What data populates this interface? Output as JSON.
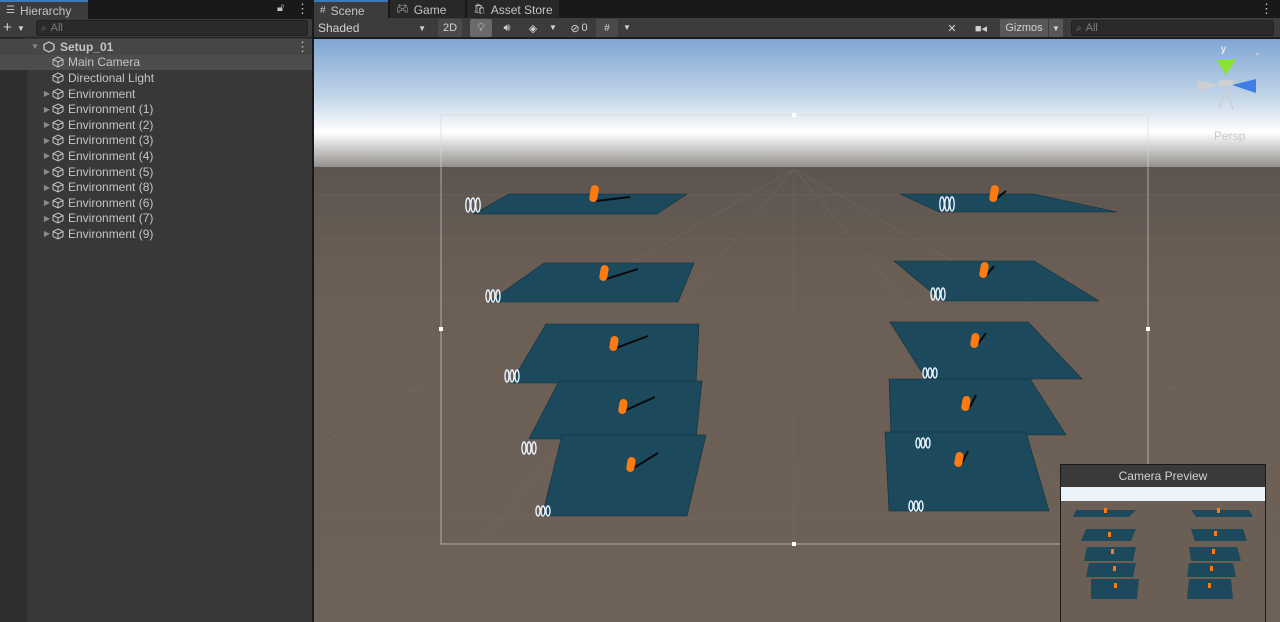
{
  "hierarchy": {
    "tab_label": "Hierarchy",
    "search_placeholder": "All",
    "scene_name": "Setup_01",
    "items": [
      {
        "label": "Main Camera",
        "expandable": false
      },
      {
        "label": "Directional Light",
        "expandable": false
      },
      {
        "label": "Environment",
        "expandable": true
      },
      {
        "label": "Environment (1)",
        "expandable": true
      },
      {
        "label": "Environment (2)",
        "expandable": true
      },
      {
        "label": "Environment (3)",
        "expandable": true
      },
      {
        "label": "Environment (4)",
        "expandable": true
      },
      {
        "label": "Environment (5)",
        "expandable": true
      },
      {
        "label": "Environment (8)",
        "expandable": true
      },
      {
        "label": "Environment (6)",
        "expandable": true
      },
      {
        "label": "Environment (7)",
        "expandable": true
      },
      {
        "label": "Environment (9)",
        "expandable": true
      }
    ]
  },
  "scene": {
    "tabs": [
      {
        "label": "Scene",
        "icon": "grid-icon"
      },
      {
        "label": "Game",
        "icon": "gamepad-icon"
      },
      {
        "label": "Asset Store",
        "icon": "bag-icon"
      }
    ],
    "shading_mode": "Shaded",
    "mode_2d": "2D",
    "hidden_count": "0",
    "gizmos_label": "Gizmos",
    "search_placeholder": "All",
    "gizmo_axis_label": "y",
    "projection_label": "Persp",
    "camera_preview_title": "Camera Preview"
  },
  "colors": {
    "accent": "#3a79bb",
    "plane": "#1c4a5c",
    "ground": "#6b5f55",
    "agent": "#ff7a10"
  }
}
